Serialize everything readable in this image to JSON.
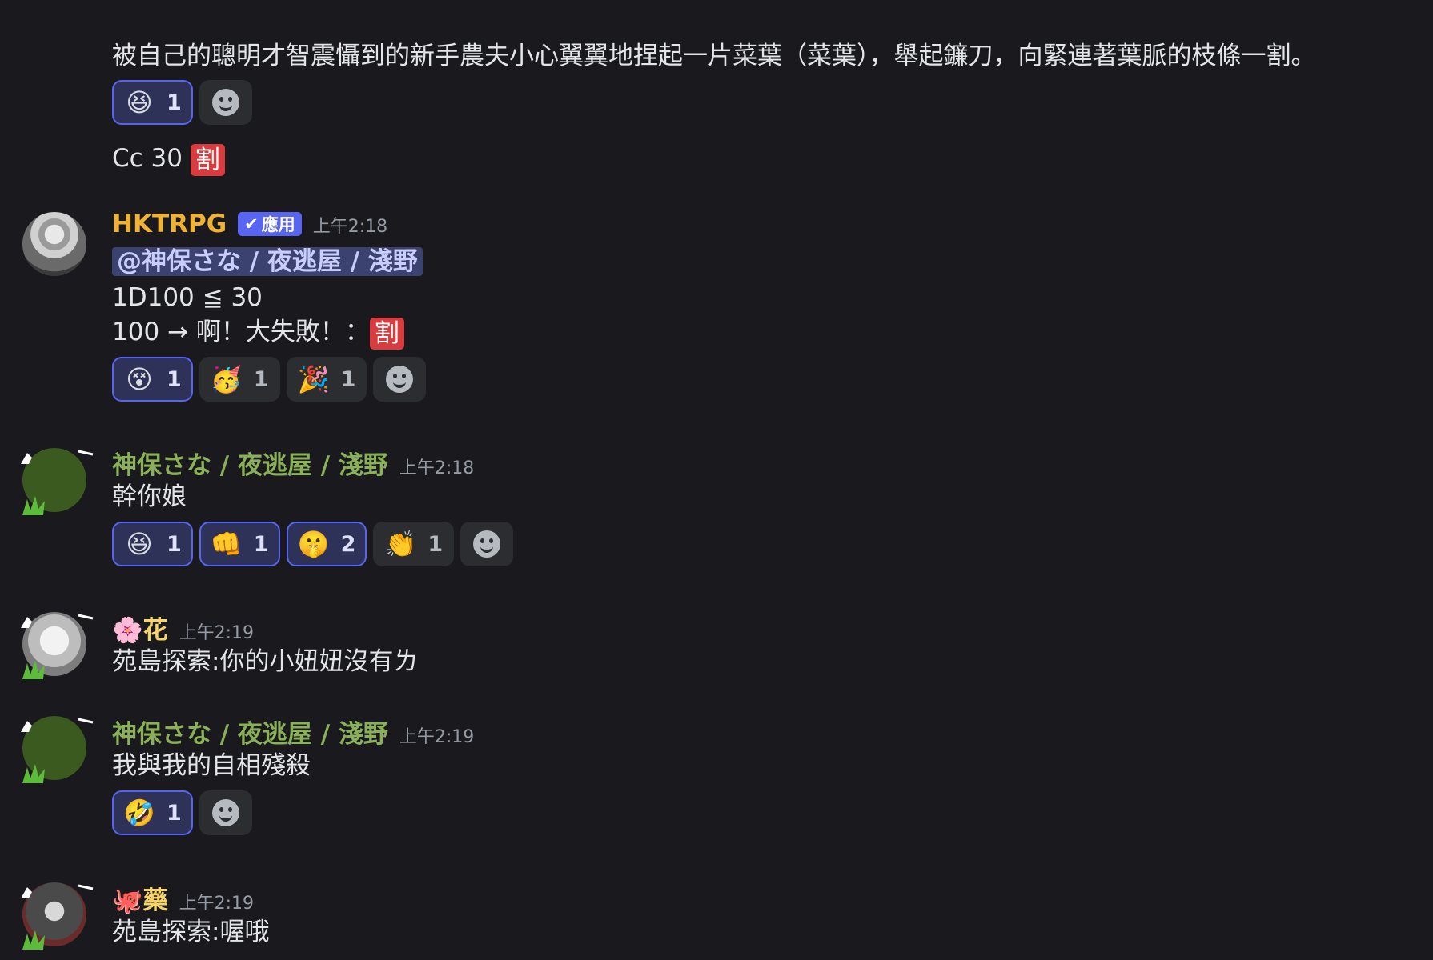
{
  "colors": {
    "accent": "#5865f2",
    "tag_red": "#d83c3e",
    "bot_name": "#f0b232",
    "green_name": "#8bb05a",
    "user_name": "#f7d56b"
  },
  "top": {
    "line1": "被自己的聰明才智震懾到的新手農夫小心翼翼地捏起一片菜葉（菜葉），舉起鐮刀，向緊連著葉脈的枝條一割。",
    "reactions": [
      {
        "emoji": "😆",
        "count": "1",
        "me": true
      }
    ],
    "cmd": "Cc 30",
    "cmd_tag": "割"
  },
  "messages": [
    {
      "author": "HKTRPG",
      "badge": "應用",
      "time": "上午2:18",
      "avatar_icon": "owl-avatar-icon",
      "mention": "@神保さな / 夜逃屋 / 淺野",
      "line1": "1D100 ≦ 30",
      "line2": "100 → 啊！大失敗！：",
      "tag": "割",
      "reactions": [
        {
          "emoji": "😵",
          "count": "1",
          "me": true
        },
        {
          "emoji": "🥳",
          "count": "1",
          "me": false
        },
        {
          "emoji": "🎉",
          "count": "1",
          "me": false
        }
      ]
    },
    {
      "author": "神保さな / 夜逃屋 / 淺野",
      "time": "上午2:18",
      "text": "幹你娘",
      "reactions": [
        {
          "emoji": "😆",
          "count": "1",
          "me": true
        },
        {
          "emoji": "👊",
          "count": "1",
          "me": true
        },
        {
          "emoji": "🤫",
          "count": "2",
          "me": true
        },
        {
          "emoji": "👏",
          "count": "1",
          "me": false
        }
      ]
    },
    {
      "author_emoji": "🌸",
      "author": "花",
      "time": "上午2:19",
      "text": "苑島探索:你的小妞妞沒有ㄌ"
    },
    {
      "author": "神保さな / 夜逃屋 / 淺野",
      "time": "上午2:19",
      "text": "我與我的自相殘殺",
      "reactions": [
        {
          "emoji": "🤣",
          "count": "1",
          "me": true
        }
      ]
    },
    {
      "author_emoji": "🐙",
      "author": "藥",
      "time": "上午2:19",
      "text": "苑島探索:喔哦"
    }
  ]
}
